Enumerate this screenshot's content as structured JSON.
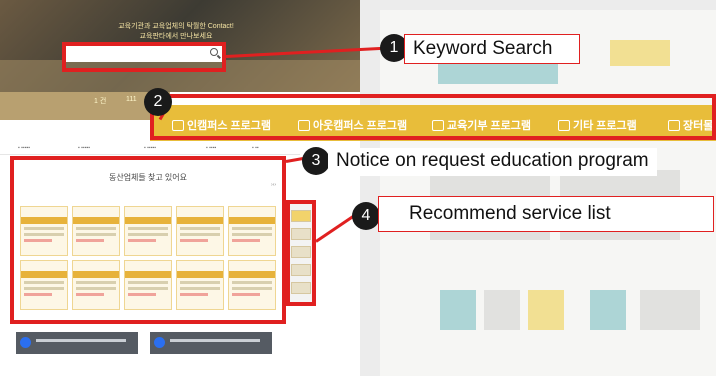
{
  "hero": {
    "tagline_line1": "교육기관과 교육업체의 탁월한 Contact!",
    "tagline_line2": "교육판타에서 만나보세요",
    "search": {
      "placeholder": ""
    }
  },
  "stats": [
    {
      "value": "1 건"
    },
    {
      "value": "111"
    }
  ],
  "nav": {
    "items": [
      {
        "label": "인캠퍼스 프로그램",
        "icon": "building-icon"
      },
      {
        "label": "아웃캠퍼스 프로그램",
        "icon": "building-icon"
      },
      {
        "label": "교육기부 프로그램",
        "icon": "school-icon"
      },
      {
        "label": "기타 프로그램",
        "icon": "document-icon"
      },
      {
        "label": "장터몰",
        "icon": "basket-icon"
      }
    ]
  },
  "panel": {
    "title": "동산업체들 찾고 있어요"
  },
  "callouts": [
    {
      "number": "1",
      "label": "Keyword Search"
    },
    {
      "number": "2",
      "label": ""
    },
    {
      "number": "3",
      "label": "Notice on request education program"
    },
    {
      "number": "4",
      "label": "Recommend service list"
    }
  ],
  "colors": {
    "annotation_red": "#e02020",
    "nav_yellow": "#e8bd3a",
    "card_bar": "#e7b23a"
  }
}
